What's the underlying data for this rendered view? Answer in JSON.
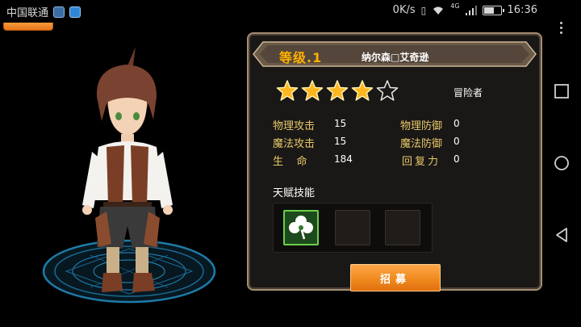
{
  "status_bar": {
    "carrier": "中国联通",
    "speed": "0K/s",
    "network": "4G",
    "time": "16:36",
    "battery_level": 0.6
  },
  "panel": {
    "level": "等级.1",
    "name": "纳尔森□艾奇逊",
    "class": "冒险者",
    "stars": {
      "filled": 4,
      "total": 5
    },
    "stats": [
      {
        "label": "物理攻击",
        "value": "15"
      },
      {
        "label": "物理防御",
        "value": "0"
      },
      {
        "label": "魔法攻击",
        "value": "15"
      },
      {
        "label": "魔法防御",
        "value": "0"
      },
      {
        "label": "生    命",
        "value": "184"
      },
      {
        "label": "回复力",
        "value": "0"
      }
    ],
    "talent_label": "天赋技能",
    "talent_slots": [
      "clover-icon",
      "",
      ""
    ],
    "recruit_button": "招募"
  },
  "colors": {
    "accent": "#ffb100",
    "button": "#f08a1e",
    "panel_border": "#a58e72",
    "stat_label": "#e8c86a"
  }
}
